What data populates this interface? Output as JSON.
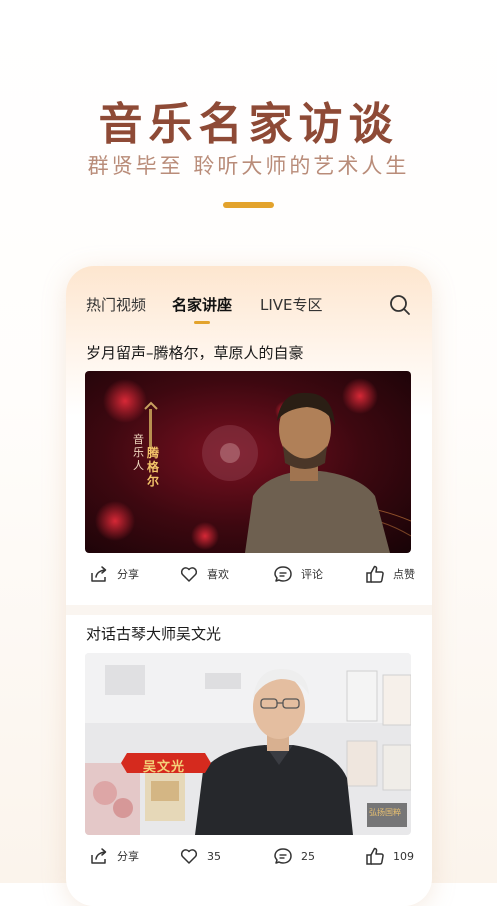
{
  "hero": {
    "title": "音乐名家访谈",
    "subtitle": "群贤毕至 聆听大师的艺术人生"
  },
  "colors": {
    "accent": "#e3a32c",
    "title": "#8e4a36",
    "subtitle": "#b98c79"
  },
  "tabs": [
    {
      "label": "热门视频"
    },
    {
      "label": "名家讲座",
      "active": true
    },
    {
      "label": "LIVE专区"
    }
  ],
  "search_icon": "search-icon",
  "posts": [
    {
      "title": "岁月留声–腾格尔，草原人的自豪",
      "overlay_vertical_1": "音乐人",
      "overlay_vertical_2": "腾格尔",
      "actions": {
        "share": "分享",
        "like": "喜欢",
        "comment": "评论",
        "upvote": "点赞"
      }
    },
    {
      "title": "对话古琴大师吴文光",
      "caption": "吴文光",
      "watermark": "弘扬国粹",
      "actions": {
        "share": "分享",
        "like": "35",
        "comment": "25",
        "upvote": "109"
      }
    }
  ]
}
